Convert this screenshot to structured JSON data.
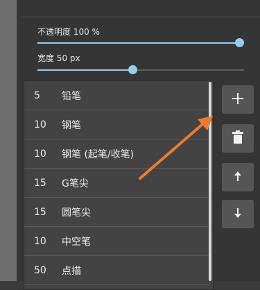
{
  "opacity": {
    "label": "不透明度 100 %",
    "value": 1.0
  },
  "width": {
    "label": "宽度 50 px",
    "value": 0.46
  },
  "brushes": [
    {
      "size": "5",
      "name": "铅笔"
    },
    {
      "size": "10",
      "name": "钢笔"
    },
    {
      "size": "10",
      "name": "钢笔 (起笔/收笔)"
    },
    {
      "size": "15",
      "name": "G笔尖"
    },
    {
      "size": "15",
      "name": "圆笔尖"
    },
    {
      "size": "10",
      "name": "中空笔"
    },
    {
      "size": "50",
      "name": "点描"
    }
  ],
  "actions": {
    "add_icon": "plus-icon",
    "delete_icon": "trash-icon",
    "move_up_icon": "arrow-up-icon",
    "move_down_icon": "arrow-down-icon"
  },
  "annotation": {
    "arrow_color": "#f07b2c"
  },
  "colors": {
    "accent": "#8fd0f2",
    "panel": "#353535",
    "list_bg": "#434343"
  }
}
